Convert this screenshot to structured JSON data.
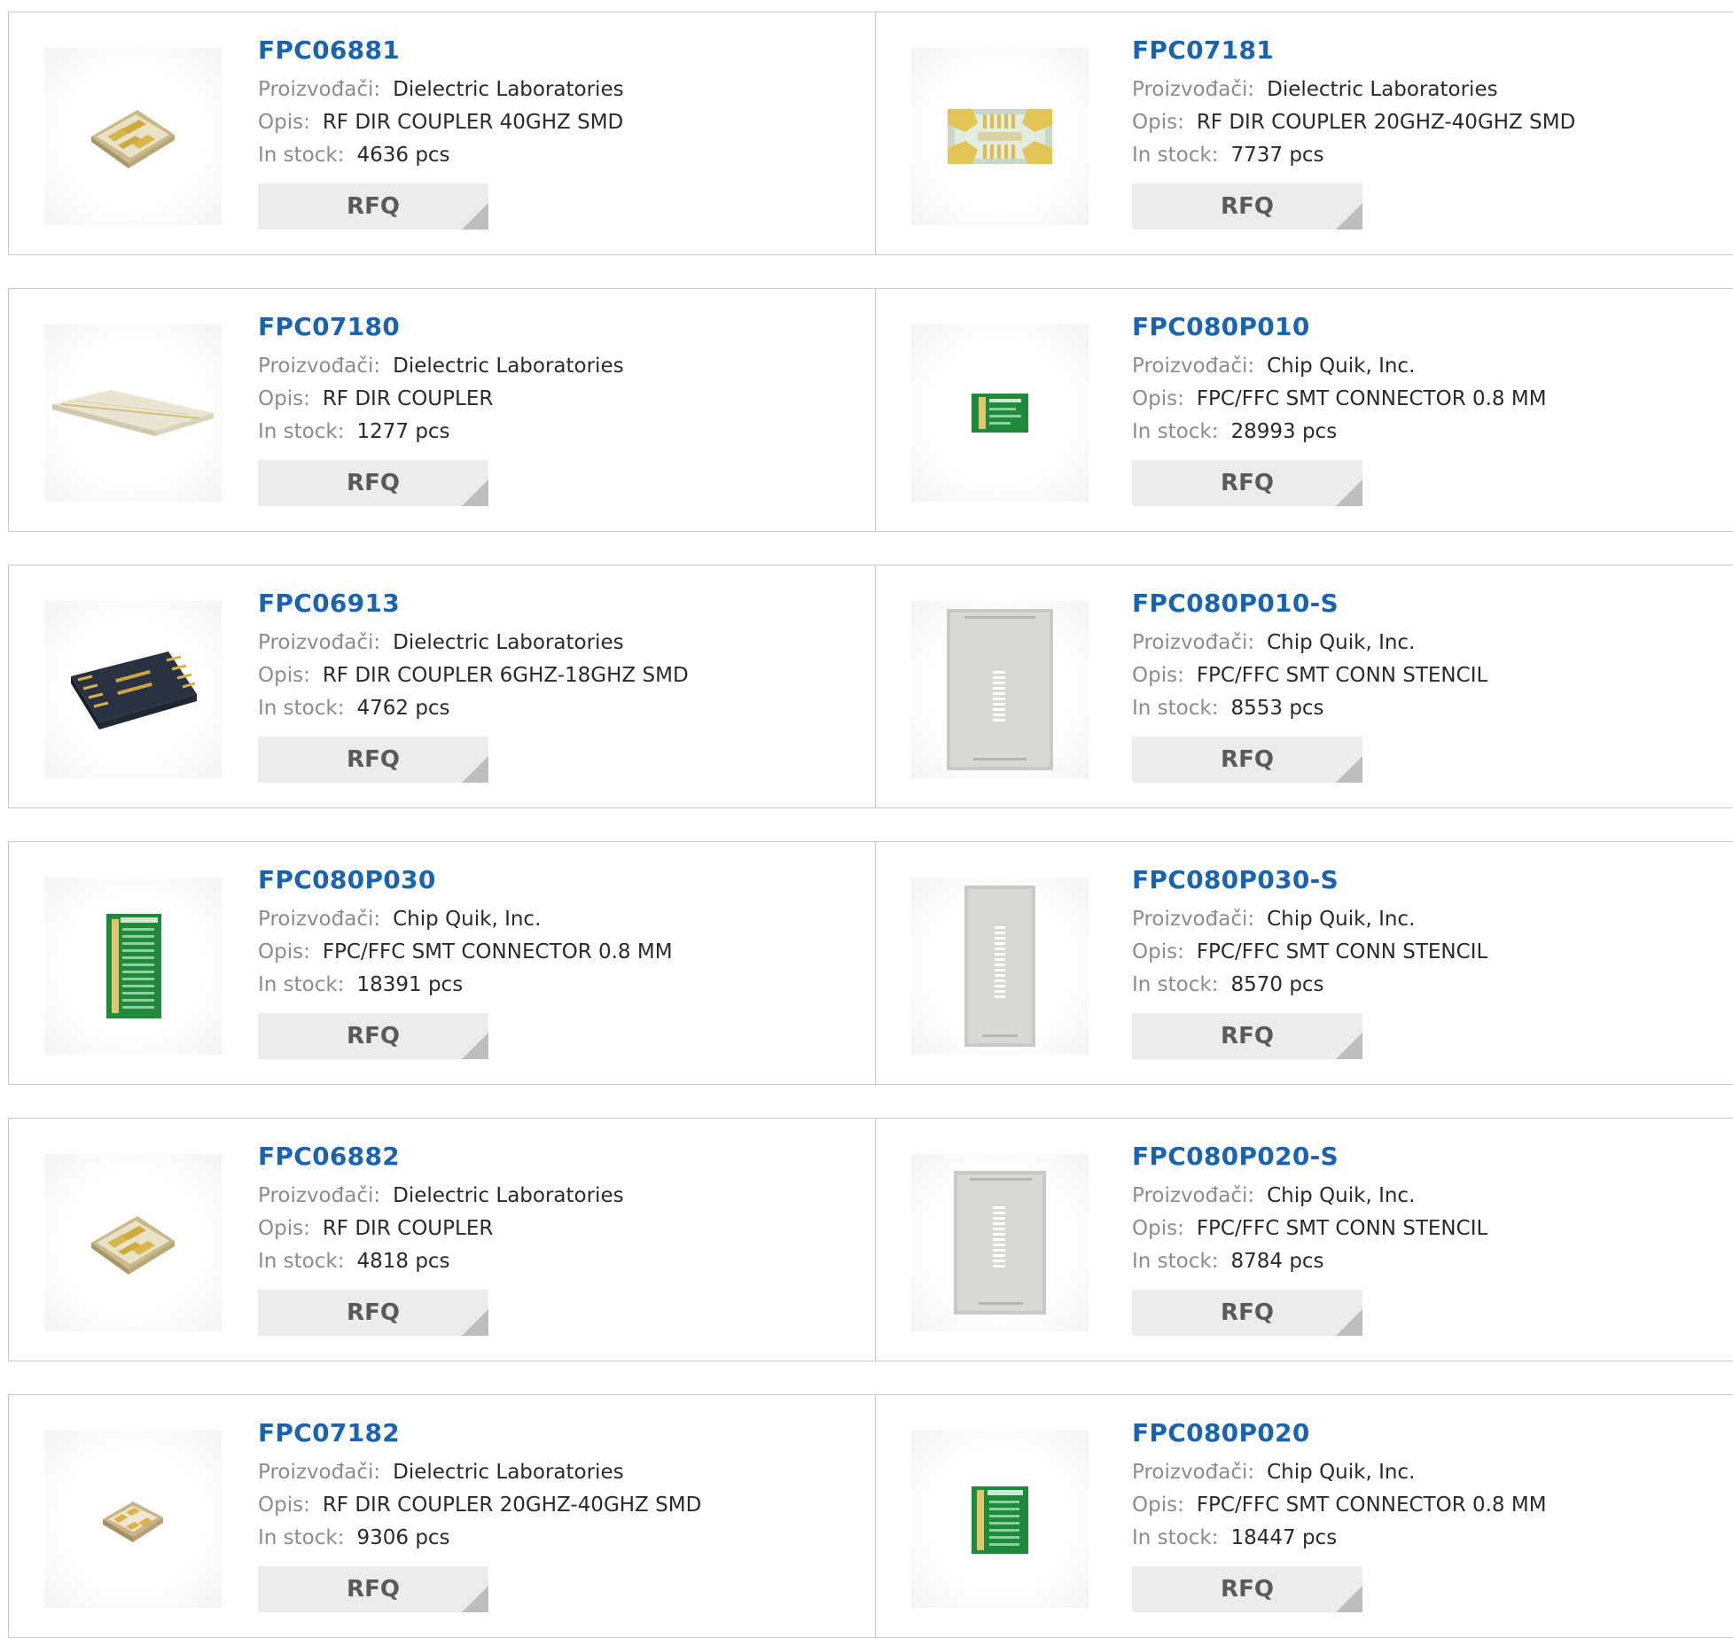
{
  "labels": {
    "manufacturer": "Proizvođači:",
    "description": "Opis:",
    "stock": "In stock:",
    "rfq": "RFQ"
  },
  "products": [
    {
      "name": "FPC06881",
      "manufacturer": "Dielectric Laboratories",
      "description": "RF DIR COUPLER 40GHZ SMD",
      "stock": "4636 pcs",
      "image": "chip-angled-gold"
    },
    {
      "name": "FPC07181",
      "manufacturer": "Dielectric Laboratories",
      "description": "RF DIR COUPLER 20GHZ-40GHZ SMD",
      "stock": "7737 pcs",
      "image": "chip-flat-gold-pads"
    },
    {
      "name": "FPC07180",
      "manufacturer": "Dielectric Laboratories",
      "description": "RF DIR COUPLER",
      "stock": "1277 pcs",
      "image": "long-ceramic-strip"
    },
    {
      "name": "FPC080P010",
      "manufacturer": "Chip Quik, Inc.",
      "description": "FPC/FFC SMT CONNECTOR 0.8 MM",
      "stock": "28993 pcs",
      "image": "small-green-pcb"
    },
    {
      "name": "FPC06913",
      "manufacturer": "Dielectric Laboratories",
      "description": "RF DIR COUPLER 6GHZ-18GHZ SMD",
      "stock": "4762 pcs",
      "image": "dark-chip-gold-leads"
    },
    {
      "name": "FPC080P010-S",
      "manufacturer": "Chip Quik, Inc.",
      "description": "FPC/FFC SMT CONN STENCIL",
      "stock": "8553 pcs",
      "image": "steel-stencil-wide"
    },
    {
      "name": "FPC080P030",
      "manufacturer": "Chip Quik, Inc.",
      "description": "FPC/FFC SMT CONNECTOR 0.8 MM",
      "stock": "18391 pcs",
      "image": "tall-green-pcb"
    },
    {
      "name": "FPC080P030-S",
      "manufacturer": "Chip Quik, Inc.",
      "description": "FPC/FFC SMT CONN STENCIL",
      "stock": "8570 pcs",
      "image": "steel-stencil-tall"
    },
    {
      "name": "FPC06882",
      "manufacturer": "Dielectric Laboratories",
      "description": "RF DIR COUPLER",
      "stock": "4818 pcs",
      "image": "chip-angled-gold"
    },
    {
      "name": "FPC080P020-S",
      "manufacturer": "Chip Quik, Inc.",
      "description": "FPC/FFC SMT CONN STENCIL",
      "stock": "8784 pcs",
      "image": "steel-stencil-medium"
    },
    {
      "name": "FPC07182",
      "manufacturer": "Dielectric Laboratories",
      "description": "RF DIR COUPLER 20GHZ-40GHZ SMD",
      "stock": "9306 pcs",
      "image": "chip-small-gold"
    },
    {
      "name": "FPC080P020",
      "manufacturer": "Chip Quik, Inc.",
      "description": "FPC/FFC SMT CONNECTOR 0.8 MM",
      "stock": "18447 pcs",
      "image": "medium-green-pcb"
    }
  ]
}
